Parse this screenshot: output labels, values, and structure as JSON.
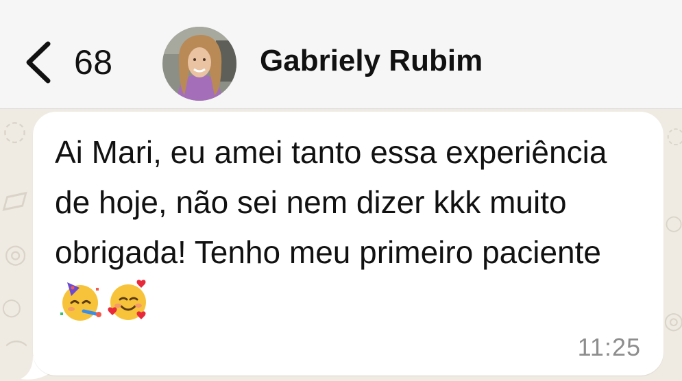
{
  "header": {
    "back_count": "68",
    "contact_name": "Gabriely Rubim"
  },
  "message": {
    "text": "Ai Mari, eu amei tanto essa experiência de hoje, não sei nem dizer kkk muito obrigada! Tenho meu primeiro paciente",
    "emojis": [
      "partying-face-icon",
      "smiling-face-with-hearts-icon"
    ],
    "time": "11:25"
  },
  "colors": {
    "header_bg": "#f6f6f6",
    "chat_bg": "#efeae2",
    "bubble_bg": "#ffffff",
    "timestamp": "#8d8d8d",
    "text": "#111111"
  }
}
